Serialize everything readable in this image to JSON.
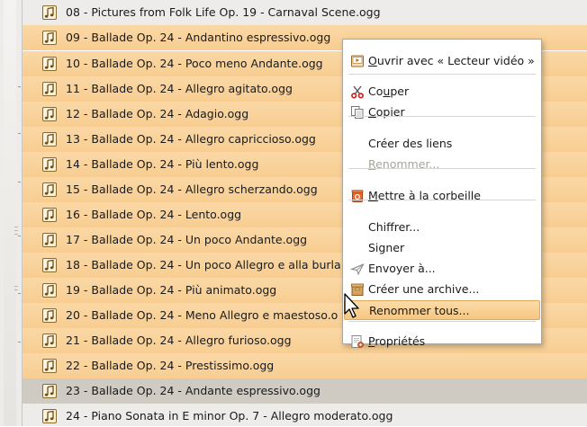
{
  "files": [
    {
      "name": "08 - Pictures from Folk Life Op. 19 - Carnaval Scene.ogg",
      "state": "plain"
    },
    {
      "name": "09 - Ballade Op. 24 - Andantino espressivo.ogg",
      "state": "selected"
    },
    {
      "name": "10 - Ballade Op. 24 - Poco meno Andante.ogg",
      "state": "selected"
    },
    {
      "name": "11 - Ballade Op. 24 - Allegro agitato.ogg",
      "state": "selected"
    },
    {
      "name": "12 - Ballade Op. 24 - Adagio.ogg",
      "state": "selected"
    },
    {
      "name": "13 - Ballade Op. 24 - Allegro capriccioso.ogg",
      "state": "selected"
    },
    {
      "name": "14 - Ballade Op. 24 - Più lento.ogg",
      "state": "selected"
    },
    {
      "name": "15 - Ballade Op. 24 - Allegro scherzando.ogg",
      "state": "selected"
    },
    {
      "name": "16 - Ballade Op. 24 - Lento.ogg",
      "state": "selected"
    },
    {
      "name": "17 - Ballade Op. 24 - Un poco Andante.ogg",
      "state": "selected"
    },
    {
      "name": "18 - Ballade Op. 24 - Un poco Allegro e alla burla",
      "state": "selected"
    },
    {
      "name": "19 - Ballade Op. 24 - Più animato.ogg",
      "state": "selected"
    },
    {
      "name": "20 - Ballade Op. 24 - Meno Allegro e maestoso.o",
      "state": "selected"
    },
    {
      "name": "21 - Ballade Op. 24 - Allegro furioso.ogg",
      "state": "selected"
    },
    {
      "name": "22 - Ballade Op. 24 - Prestissimo.ogg",
      "state": "selected"
    },
    {
      "name": "23 - Ballade Op. 24 - Andante espressivo.ogg",
      "state": "focused"
    },
    {
      "name": "24 - Piano Sonata in E minor Op. 7 - Allegro moderato.ogg",
      "state": "plain"
    }
  ],
  "context_menu": {
    "items": [
      {
        "key": "open-with",
        "pre": "",
        "u": "O",
        "post": "uvrir avec « Lecteur vidéo »",
        "icon": "video-player-icon",
        "disabled": false,
        "hover": false
      },
      {
        "type": "separator"
      },
      {
        "key": "cut",
        "pre": "Co",
        "u": "u",
        "post": "per",
        "icon": "scissors-icon",
        "disabled": false,
        "hover": false
      },
      {
        "key": "copy",
        "pre": "",
        "u": "C",
        "post": "opier",
        "icon": "copy-icon",
        "disabled": false,
        "hover": false
      },
      {
        "type": "separator"
      },
      {
        "key": "create-links",
        "pre": "",
        "u": "",
        "post": "Créer des liens",
        "icon": "",
        "disabled": false,
        "hover": false
      },
      {
        "key": "rename",
        "pre": "",
        "u": "R",
        "post": "enommer...",
        "icon": "",
        "disabled": true,
        "hover": false
      },
      {
        "type": "separator"
      },
      {
        "key": "move-to-trash",
        "pre": "",
        "u": "M",
        "post": "ettre à la corbeille",
        "icon": "trash-icon",
        "disabled": false,
        "hover": false
      },
      {
        "type": "separator"
      },
      {
        "key": "encrypt",
        "pre": "",
        "u": "",
        "post": "Chiffrer...",
        "icon": "",
        "disabled": false,
        "hover": false
      },
      {
        "key": "sign",
        "pre": "",
        "u": "",
        "post": "Signer",
        "icon": "",
        "disabled": false,
        "hover": false
      },
      {
        "key": "send-to",
        "pre": "",
        "u": "",
        "post": "Envoyer à...",
        "icon": "send-icon",
        "disabled": false,
        "hover": false
      },
      {
        "key": "create-archive",
        "pre": "",
        "u": "",
        "post": "Créer une archive...",
        "icon": "archive-icon",
        "disabled": false,
        "hover": false
      },
      {
        "key": "rename-all",
        "pre": "",
        "u": "",
        "post": "Renommer tous...",
        "icon": "",
        "disabled": false,
        "hover": true
      },
      {
        "type": "separator"
      },
      {
        "key": "properties",
        "pre": "",
        "u": "P",
        "post": "ropriétés",
        "icon": "properties-icon",
        "disabled": false,
        "hover": false
      }
    ]
  }
}
